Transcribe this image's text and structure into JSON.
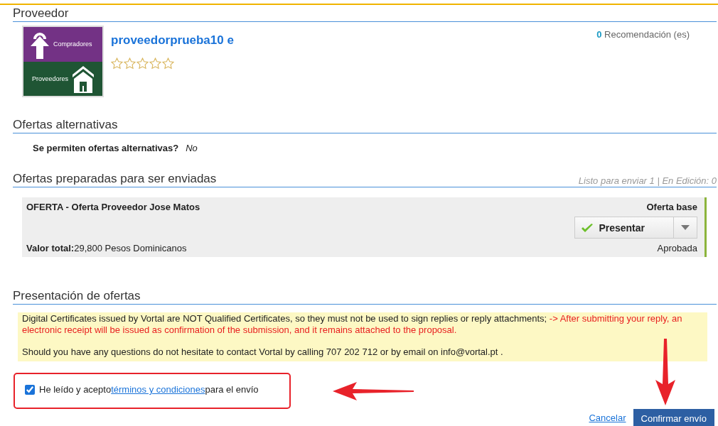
{
  "provider": {
    "heading": "Proveedor",
    "logo_top_text": "Compradores",
    "logo_bottom_text": "Proveedores",
    "name": "proveedorprueba10 e",
    "stars": 0,
    "recommend_count": "0",
    "recommend_label": "Recomendación (es)"
  },
  "alternatives": {
    "heading": "Ofertas alternativas",
    "question": "Se permiten ofertas alternativas?",
    "answer": "No"
  },
  "prepared": {
    "heading": "Ofertas preparadas para ser enviadas",
    "summary": "Listo para enviar 1 | En Edición: 0",
    "offers": [
      {
        "title": "OFERTA - Oferta Proveedor Jose Matos",
        "type": "Oferta base",
        "action": "Presentar",
        "total_label": "Valor total:",
        "total_value": "29,800 Pesos Dominicanos",
        "status": "Aprobada"
      }
    ]
  },
  "submission": {
    "heading": "Presentación de ofertas",
    "notice": [
      {
        "kind": "normal",
        "text": "Digital Certificates issued by Vortal are NOT Qualified Certificates, so they must not be used to sign replies or reply attachments;"
      },
      {
        "kind": "warning",
        "text": "-> After submitting your reply, an electronic receipt will be issued as confirmation of the submission, and it remains attached to the proposal."
      }
    ],
    "contact": "Should you have any questions do not hesitate to contact Vortal by calling 707 202 712 or by email on info@vortal.pt .",
    "accept": {
      "checked": true,
      "before": "He leído y acepto",
      "link": "términos y condiciones",
      "after": "para el envío"
    },
    "cancel": "Cancelar",
    "confirm": "Confirmar envío"
  }
}
